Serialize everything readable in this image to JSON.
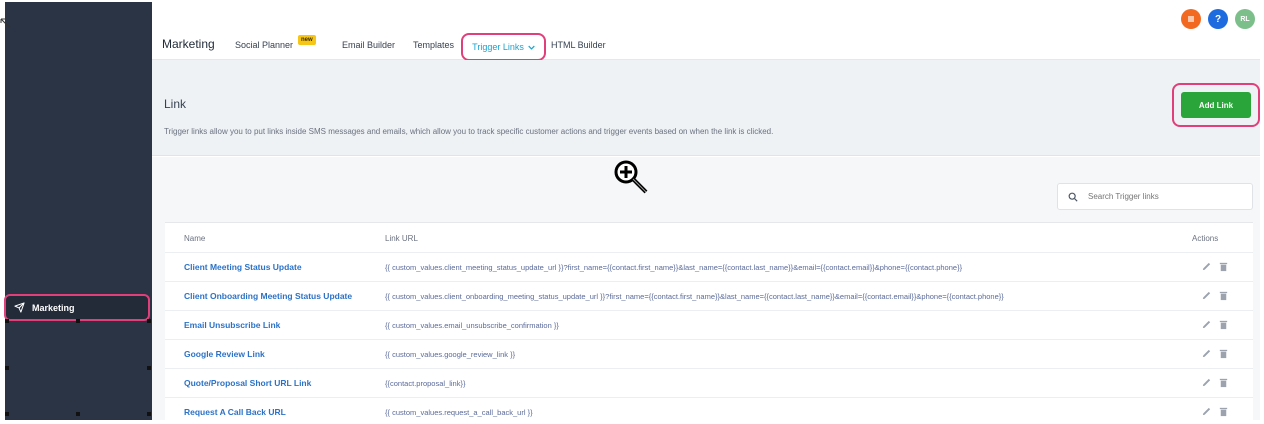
{
  "sidebar": {
    "active_item": {
      "label": "Marketing",
      "icon": "send-icon"
    }
  },
  "header": {
    "app_title": "Marketing",
    "tabs": [
      {
        "label": "Social Planner",
        "badge": "new"
      },
      {
        "label": "Email Builder"
      },
      {
        "label": "Templates"
      },
      {
        "label": "Trigger Links",
        "active": true
      },
      {
        "label": "HTML Builder"
      }
    ],
    "icons": [
      {
        "name": "list-icon",
        "color": "#f26a21"
      },
      {
        "name": "help-icon",
        "glyph": "?",
        "color": "#1e6be0"
      },
      {
        "name": "avatar",
        "glyph": "RL",
        "color": "#7cbf8a"
      }
    ]
  },
  "banner": {
    "title": "Link",
    "description": "Trigger links allow you to put links inside SMS messages and emails, which allow you to track specific customer actions and trigger events based on when the link is clicked.",
    "add_button": "Add Link"
  },
  "search": {
    "placeholder": "Search Trigger links"
  },
  "table": {
    "columns": [
      "Name",
      "Link URL",
      "Actions"
    ],
    "rows": [
      {
        "name": "Client Meeting Status Update",
        "url": "{{ custom_values.client_meeting_status_update_url }}?first_name={{contact.first_name}}&last_name={{contact.last_name}}&email={{contact.email}}&phone={{contact.phone}}"
      },
      {
        "name": "Client Onboarding Meeting Status Update",
        "url": "{{ custom_values.client_onboarding_meeting_status_update_url }}?first_name={{contact.first_name}}&last_name={{contact.last_name}}&email={{contact.email}}&phone={{contact.phone}}"
      },
      {
        "name": "Email Unsubscribe Link",
        "url": "{{ custom_values.email_unsubscribe_confirmation }}"
      },
      {
        "name": "Google Review Link",
        "url": "{{ custom_values.google_review_link }}"
      },
      {
        "name": "Quote/Proposal Short URL Link",
        "url": "{{contact.proposal_link}}"
      },
      {
        "name": "Request A Call Back URL",
        "url": "{{ custom_values.request_a_call_back_url }}"
      }
    ]
  },
  "colors": {
    "sidebar_bg": "#2b3445",
    "highlight": "#e03f7a",
    "accent": "#1aa3d0",
    "primary_button": "#2aa53a",
    "link_text": "#2b72c7"
  }
}
